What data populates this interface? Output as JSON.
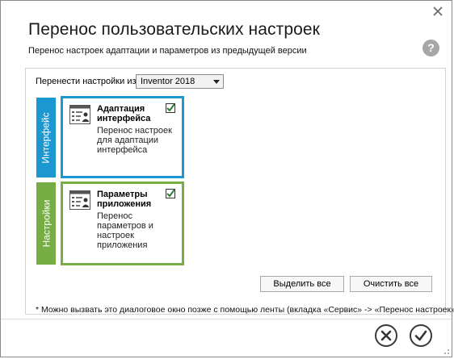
{
  "dialog": {
    "title": "Перенос пользовательских настроек",
    "subtitle": "Перенос настроек адаптации и параметров из предыдущей версии",
    "close_icon": "close-icon",
    "help_label": "?"
  },
  "migrate_from": {
    "label": "Перенести настройки из:",
    "selected": "Inventor 2018"
  },
  "categories": [
    {
      "tab_label": "Интерфейс",
      "tab_color": "#1b98cf",
      "card": {
        "title": "Адаптация интерфейса",
        "description": "Перенос настроек для адаптации интерфейса",
        "checked": true,
        "icon": "settings-form-icon"
      }
    },
    {
      "tab_label": "Настройки",
      "tab_color": "#76ad44",
      "card": {
        "title": "Параметры приложения",
        "description": "Перенос параметров и настроек приложения",
        "checked": true,
        "icon": "settings-form-icon"
      }
    }
  ],
  "buttons": {
    "select_all": "Выделить все",
    "clear_all": "Очистить все"
  },
  "footnote": "* Можно вызвать это диалоговое окно позже с помощью ленты (вкладка «Сервис» -> «Перенос настроек»).",
  "footer": {
    "cancel_icon": "cancel-icon",
    "ok_icon": "ok-icon"
  },
  "colors": {
    "interface_accent": "#1b98cf",
    "settings_accent": "#76ad44",
    "check_green": "#2e7d32"
  }
}
